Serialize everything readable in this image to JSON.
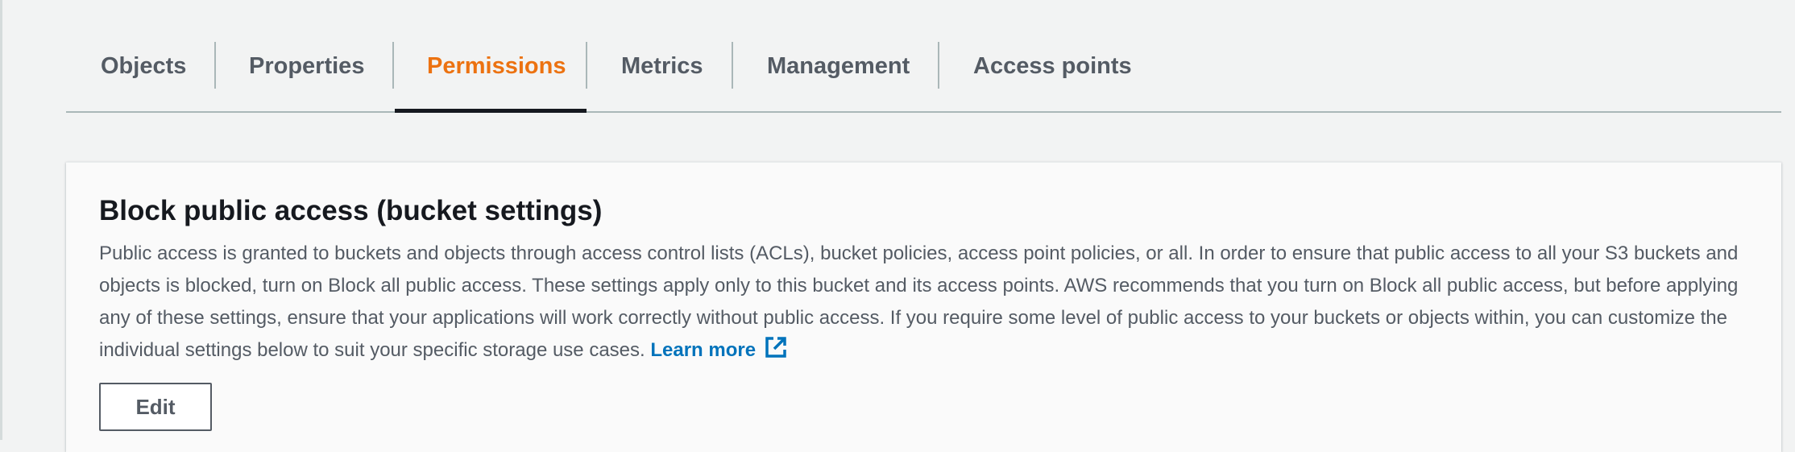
{
  "tabs": [
    {
      "label": "Objects",
      "active": false
    },
    {
      "label": "Properties",
      "active": false
    },
    {
      "label": "Permissions",
      "active": true
    },
    {
      "label": "Metrics",
      "active": false
    },
    {
      "label": "Management",
      "active": false
    },
    {
      "label": "Access points",
      "active": false
    }
  ],
  "block_public_access": {
    "title": "Block public access (bucket settings)",
    "description": "Public access is granted to buckets and objects through access control lists (ACLs), bucket policies, access point policies, or all. In order to ensure that public access to all your S3 buckets and objects is blocked, turn on Block all public access. These settings apply only to this bucket and its access points. AWS recommends that you turn on Block all public access, but before applying any of these settings, ensure that your applications will work correctly without public access. If you require some level of public access to your buckets or objects within, you can customize the individual settings below to suit your specific storage use cases.",
    "learn_more_label": "Learn more",
    "learn_more_icon": "external-link-icon",
    "edit_label": "Edit"
  },
  "colors": {
    "active_tab": "#ec7211",
    "link": "#0073bb",
    "text": "#545b64",
    "heading": "#16191f"
  }
}
